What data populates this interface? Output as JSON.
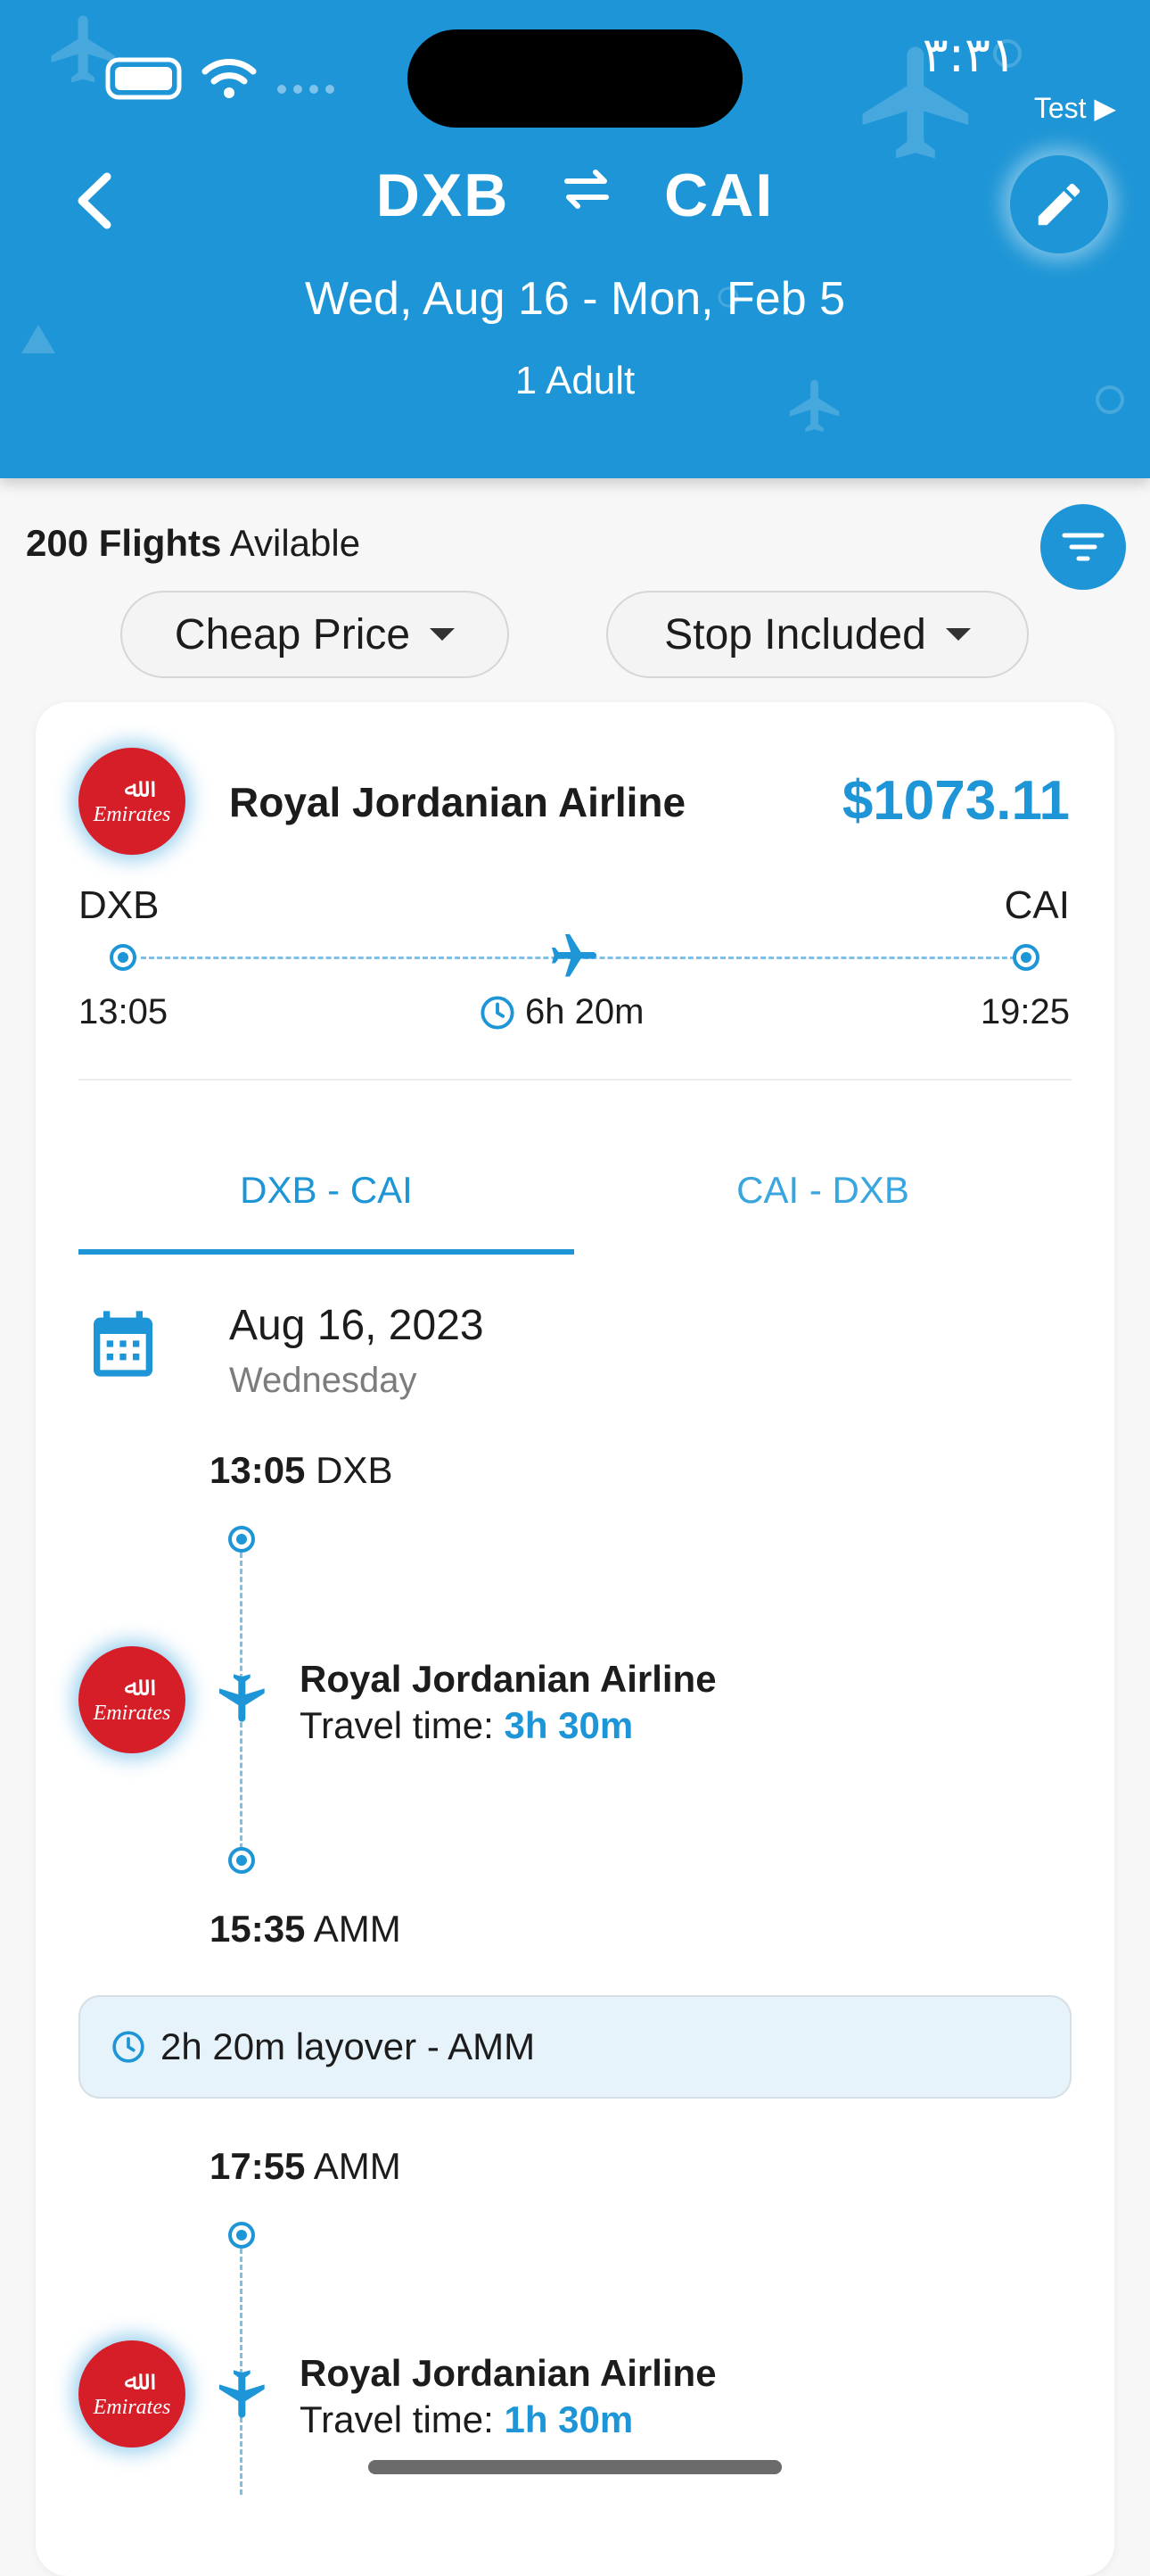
{
  "status_bar": {
    "time": "٣:٣١",
    "back_label": "Test ▶"
  },
  "header": {
    "origin": "DXB",
    "destination": "CAI",
    "dates": "Wed, Aug 16 - Mon, Feb 5",
    "passengers": "1 Adult"
  },
  "results": {
    "count": "200 Flights",
    "available_text": "Avilable",
    "sort_chip": "Cheap Price",
    "stops_chip": "Stop Included"
  },
  "flight_card": {
    "airline": "Royal Jordanian Airline",
    "logo_text": "Emirates",
    "price": "$1073.11",
    "from_code": "DXB",
    "to_code": "CAI",
    "depart_time": "13:05",
    "arrive_time": "19:25",
    "duration": "6h 20m",
    "tabs": [
      "DXB - CAI",
      "CAI - DXB"
    ],
    "active_tab": 0,
    "date": "Aug 16, 2023",
    "weekday": "Wednesday",
    "legs": [
      {
        "depart_time": "13:05",
        "depart_code": "DXB",
        "airline": "Royal Jordanian Airline",
        "travel_label": "Travel time:",
        "travel_time": "3h 30m",
        "arrive_time": "15:35",
        "arrive_code": "AMM"
      },
      {
        "depart_time": "17:55",
        "depart_code": "AMM",
        "airline": "Royal Jordanian Airline",
        "travel_label": "Travel time:",
        "travel_time": "1h 30m"
      }
    ],
    "layover": "2h 20m layover - AMM"
  },
  "colors": {
    "primary": "#1d95d6",
    "logo_red": "#d51e28",
    "layover_bg": "#e7f3fb"
  },
  "icons": [
    "back-chevron-icon",
    "swap-arrows-icon",
    "edit-pencil-icon",
    "filter-icon",
    "caret-down-icon",
    "airplane-icon",
    "clock-icon",
    "calendar-icon",
    "wifi-icon",
    "battery-icon"
  ]
}
